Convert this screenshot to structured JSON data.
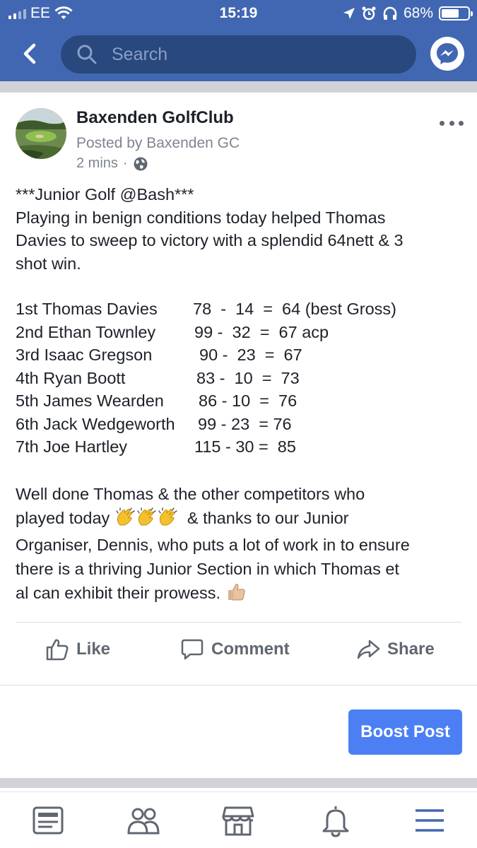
{
  "status_bar": {
    "carrier": "EE",
    "time": "15:19",
    "battery": "68%",
    "battery_level": 0.68
  },
  "nav": {
    "search_placeholder": "Search",
    "icons": [
      "back-arrow-icon",
      "search-icon",
      "messenger-icon"
    ]
  },
  "post": {
    "page_name": "Baxenden GolfClub",
    "posted_by": "Posted by Baxenden GC",
    "time_ago": "2 mins",
    "separator": "·",
    "privacy_icon": "globe-icon",
    "intro_lines": [
      "***Junior Golf @Bash***",
      "Playing in benign conditions today helped Thomas",
      "Davies to sweep to victory with a splendid 64nett & 3",
      "shot win."
    ],
    "results": [
      {
        "name": "1st Thomas Davies",
        "score": "78  -  14  =  64 (best Gross)"
      },
      {
        "name": "2nd Ethan Townley",
        "score": "99 -  32  =  67 acp"
      },
      {
        "name": "3rd Isaac Gregson",
        "score": "90 -  23  =  67"
      },
      {
        "name": "4th Ryan Boott",
        "score": "83 -  10  =  73"
      },
      {
        "name": "5th James Wearden",
        "score": "86 - 10  =  76"
      },
      {
        "name": "6th Jack Wedgeworth",
        "score": "99 - 23  = 76"
      },
      {
        "name": "7th Joe Hartley",
        "score": "115 - 30 =  85"
      }
    ],
    "closing": {
      "line1": "Well done Thomas & the other competitors who",
      "line2_before": "played today",
      "line2_after": " & thanks to our Junior",
      "line3": "Organiser, Dennis, who puts a lot of work in to ensure",
      "line4": "there is a thriving Junior Section in which Thomas et",
      "line5": "al can exhibit their prowess.",
      "emojis": [
        "clapping-hands-icon",
        "clapping-hands-icon",
        "clapping-hands-icon",
        "thumbs-up-icon"
      ]
    },
    "actions": {
      "like": "Like",
      "comment": "Comment",
      "share": "Share"
    },
    "boost_label": "Boost Post"
  },
  "tabbar": {
    "tabs": [
      "news-feed-icon",
      "friends-icon",
      "marketplace-icon",
      "notifications-bell-icon",
      "menu-icon"
    ],
    "active": "menu-icon"
  },
  "colors": {
    "brand_blue": "#4267b2",
    "search_bg": "#29487d",
    "boost_blue": "#4b7ff3",
    "muted_text": "#606770"
  }
}
